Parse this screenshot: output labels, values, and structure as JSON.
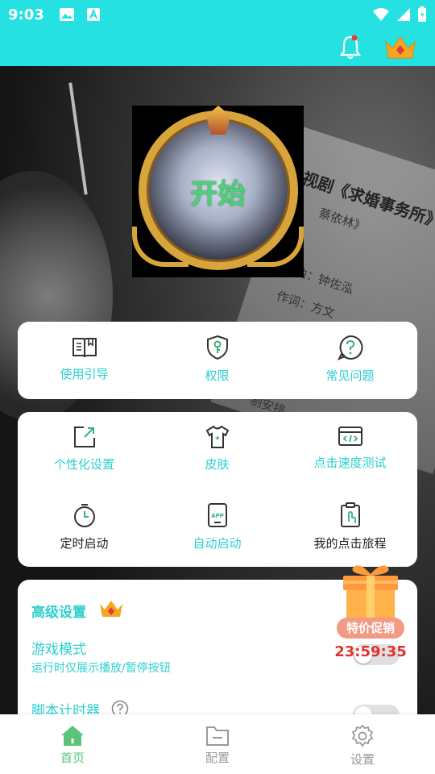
{
  "status_bar": {
    "time": "9:03",
    "icons": [
      "image-icon",
      "a-box-icon",
      "wifi-icon",
      "signal-icon",
      "battery-charging-icon"
    ]
  },
  "top_bar": {
    "icons": [
      "bell-icon",
      "crown-icon"
    ],
    "bell_has_dot": true
  },
  "background": {
    "text_lines": [
      "视剧《求婚事务所》",
      "蔡依林》",
      "曲：钟佐泓",
      "作词：方文",
      "制安排"
    ]
  },
  "avatar": {
    "start_label": "开始"
  },
  "card1": {
    "items": [
      {
        "label": "使用引导",
        "icon": "book-icon"
      },
      {
        "label": "权限",
        "icon": "shield-key-icon"
      },
      {
        "label": "常见问题",
        "icon": "question-icon"
      }
    ]
  },
  "card2": {
    "items": [
      {
        "label": "个性化设置",
        "icon": "expand-square-icon"
      },
      {
        "label": "皮肤",
        "icon": "tshirt-icon"
      },
      {
        "label": "点击速度测试",
        "icon": "code-window-icon"
      },
      {
        "label": "定时启动",
        "icon": "timer-icon"
      },
      {
        "label": "自动启动",
        "icon": "app-phone-icon"
      },
      {
        "label": "我的点击旅程",
        "icon": "clipboard-tap-icon"
      }
    ]
  },
  "card3": {
    "title": "高级设置",
    "game_mode": {
      "title": "游戏模式",
      "subtitle": "运行时仅展示播放/暂停按钮",
      "enabled": false
    },
    "script_timer": {
      "title": "脚本计时器",
      "enabled": false
    }
  },
  "promo": {
    "badge": "特价促销",
    "countdown": "23:59:35"
  },
  "bottom_nav": [
    {
      "label": "首页",
      "icon": "home-icon",
      "active": true
    },
    {
      "label": "配置",
      "icon": "folder-icon",
      "active": false
    },
    {
      "label": "设置",
      "icon": "gear-icon",
      "active": false
    }
  ],
  "colors": {
    "accent": "#26e1e1",
    "teal_text": "#2ccfcf",
    "nav_active": "#5cc47a",
    "promo_red": "#e0322f"
  }
}
